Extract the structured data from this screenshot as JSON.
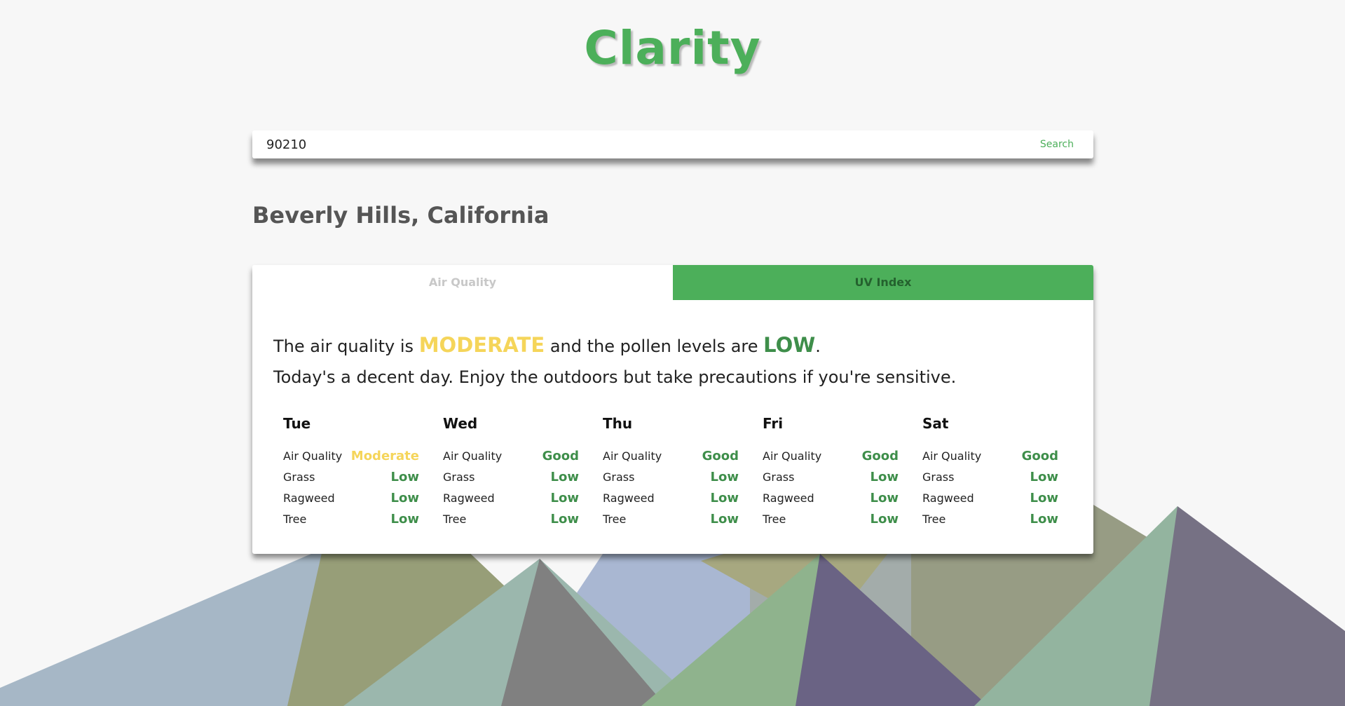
{
  "app": {
    "title": "Clarity"
  },
  "search": {
    "value": "90210",
    "button_label": "Search"
  },
  "location": "Beverly Hills, California",
  "tabs": [
    {
      "label": "Air Quality",
      "active": true
    },
    {
      "label": "UV Index",
      "active": false
    }
  ],
  "summary": {
    "line1_prefix": "The air quality is",
    "air_quality_level": "MODERATE",
    "line1_middle": "and the pollen levels are",
    "pollen_level": "LOW",
    "line1_suffix": ".",
    "line2": "Today's a decent day. Enjoy the outdoors but take precautions if you're sensitive."
  },
  "forecast": [
    {
      "day": "Tue",
      "rows": [
        {
          "label": "Air Quality",
          "value": "Moderate",
          "status": "moderate"
        },
        {
          "label": "Grass",
          "value": "Low",
          "status": "low"
        },
        {
          "label": "Ragweed",
          "value": "Low",
          "status": "low"
        },
        {
          "label": "Tree",
          "value": "Low",
          "status": "low"
        }
      ]
    },
    {
      "day": "Wed",
      "rows": [
        {
          "label": "Air Quality",
          "value": "Good",
          "status": "good"
        },
        {
          "label": "Grass",
          "value": "Low",
          "status": "low"
        },
        {
          "label": "Ragweed",
          "value": "Low",
          "status": "low"
        },
        {
          "label": "Tree",
          "value": "Low",
          "status": "low"
        }
      ]
    },
    {
      "day": "Thu",
      "rows": [
        {
          "label": "Air Quality",
          "value": "Good",
          "status": "good"
        },
        {
          "label": "Grass",
          "value": "Low",
          "status": "low"
        },
        {
          "label": "Ragweed",
          "value": "Low",
          "status": "low"
        },
        {
          "label": "Tree",
          "value": "Low",
          "status": "low"
        }
      ]
    },
    {
      "day": "Fri",
      "rows": [
        {
          "label": "Air Quality",
          "value": "Good",
          "status": "good"
        },
        {
          "label": "Grass",
          "value": "Low",
          "status": "low"
        },
        {
          "label": "Ragweed",
          "value": "Low",
          "status": "low"
        },
        {
          "label": "Tree",
          "value": "Low",
          "status": "low"
        }
      ]
    },
    {
      "day": "Sat",
      "rows": [
        {
          "label": "Air Quality",
          "value": "Good",
          "status": "good"
        },
        {
          "label": "Grass",
          "value": "Low",
          "status": "low"
        },
        {
          "label": "Ragweed",
          "value": "Low",
          "status": "low"
        },
        {
          "label": "Tree",
          "value": "Low",
          "status": "low"
        }
      ]
    }
  ],
  "colors": {
    "brand": "#4caf5a",
    "good": "#3e8e4a",
    "moderate": "#f5d55a",
    "background": "#f7f7f7"
  }
}
